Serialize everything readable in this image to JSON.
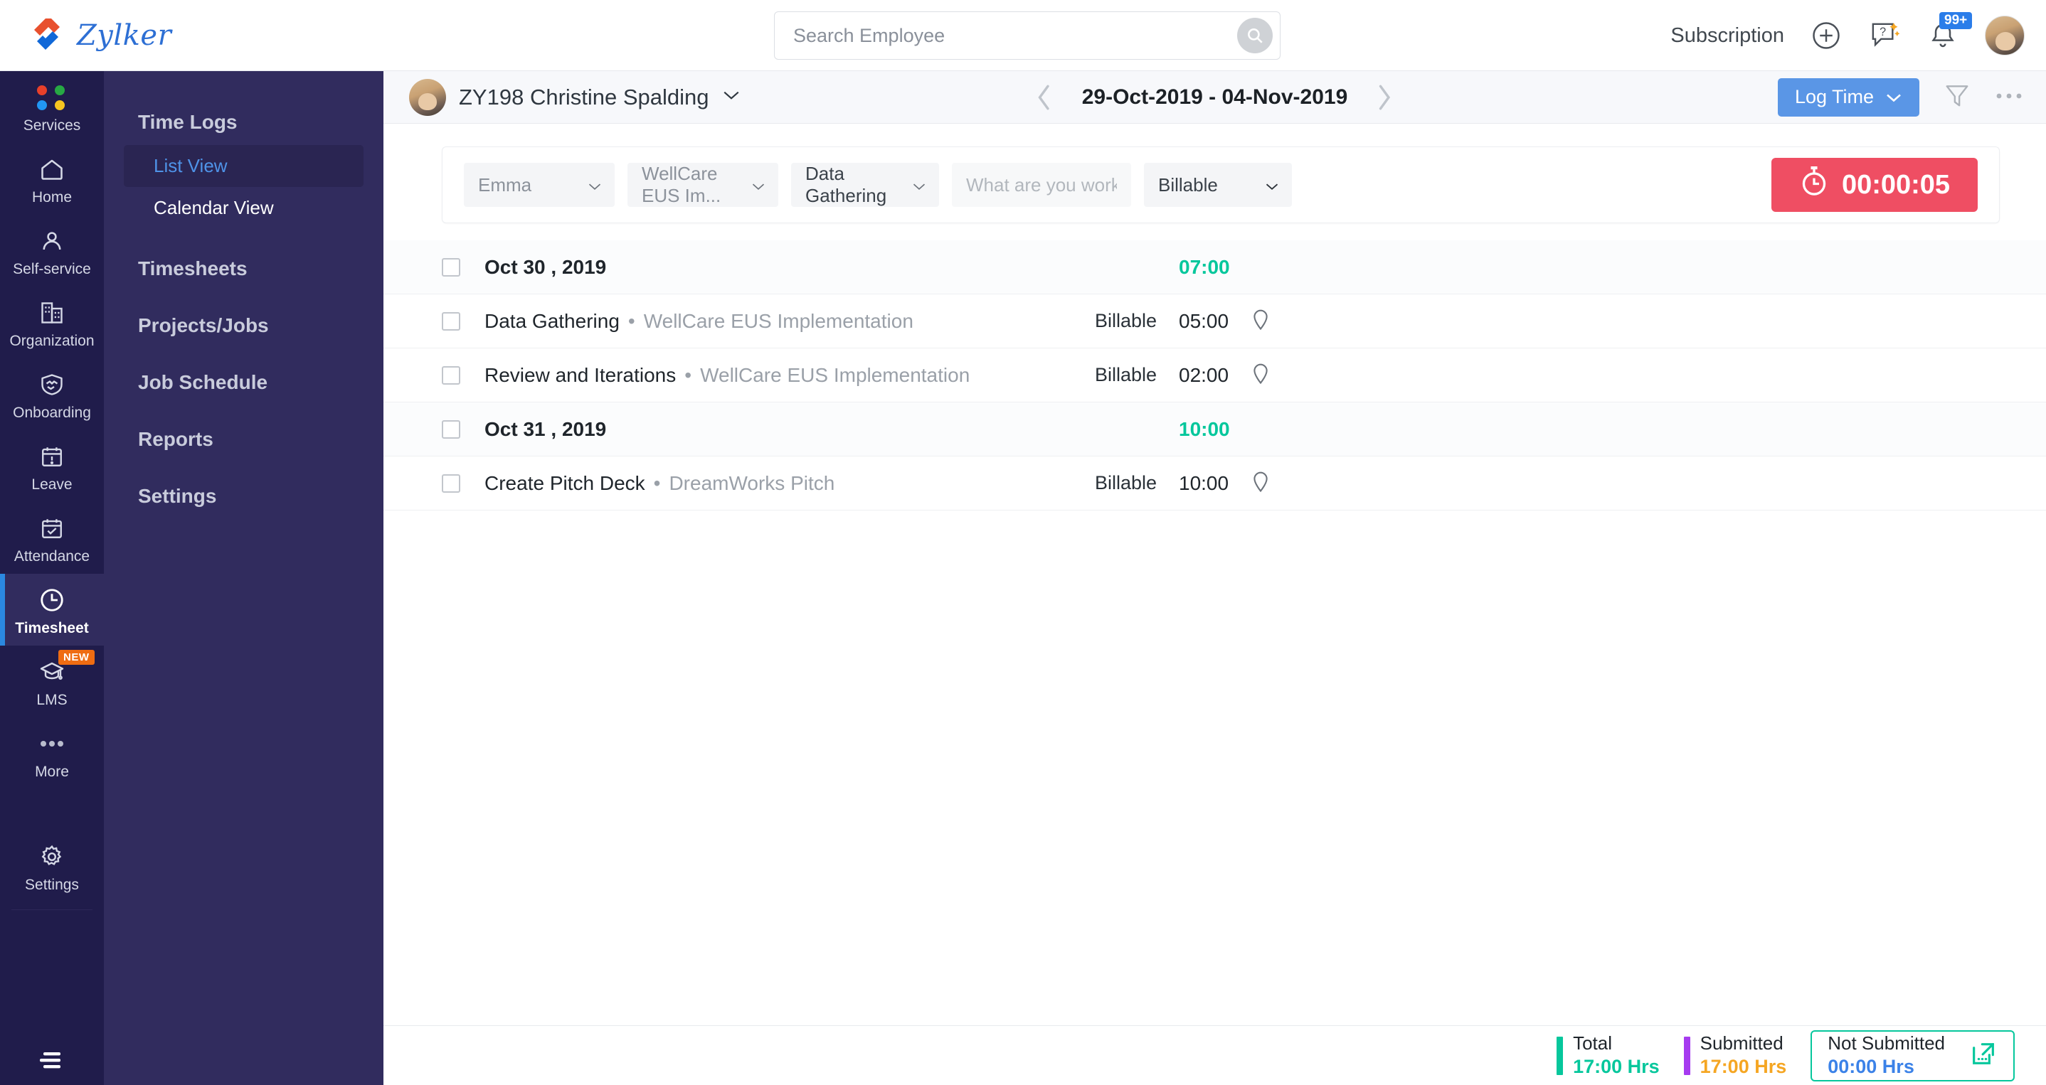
{
  "brand": {
    "name": "Zylker"
  },
  "topbar": {
    "search": {
      "placeholder": "Search Employee",
      "value": "",
      "icon": "search-icon"
    },
    "subscription_label": "Subscription",
    "add_icon": "plus-circle-icon",
    "help_icon": "help-chat-icon",
    "notification_icon": "bell-icon",
    "notification_badge": "99+",
    "avatar_icon": "user-avatar"
  },
  "rail": {
    "items": [
      {
        "label": "Services",
        "icon": "services-dots-icon",
        "active": false
      },
      {
        "label": "Home",
        "icon": "home-icon",
        "active": false
      },
      {
        "label": "Self-service",
        "icon": "person-icon",
        "active": false
      },
      {
        "label": "Organization",
        "icon": "buildings-icon",
        "active": false
      },
      {
        "label": "Onboarding",
        "icon": "handshake-shield-icon",
        "active": false
      },
      {
        "label": "Leave",
        "icon": "calendar-alert-icon",
        "active": false
      },
      {
        "label": "Attendance",
        "icon": "calendar-check-icon",
        "active": false
      },
      {
        "label": "Timesheet",
        "icon": "clock-icon",
        "active": true
      },
      {
        "label": "LMS",
        "icon": "graduation-cap-icon",
        "active": false,
        "badge": "NEW"
      },
      {
        "label": "More",
        "icon": "ellipsis-icon",
        "active": false
      },
      {
        "label": "Settings",
        "icon": "gear-icon",
        "active": false
      }
    ],
    "menu_icon": "hamburger-icon"
  },
  "subnav": {
    "groups": [
      {
        "title": "Time Logs",
        "children": [
          {
            "label": "List View",
            "active": true
          },
          {
            "label": "Calendar View",
            "active": false
          }
        ]
      }
    ],
    "items": [
      {
        "label": "Timesheets"
      },
      {
        "label": "Projects/Jobs"
      },
      {
        "label": "Job Schedule"
      },
      {
        "label": "Reports"
      },
      {
        "label": "Settings"
      }
    ]
  },
  "content_header": {
    "employee": "ZY198 Christine Spalding",
    "employee_chevron": "chevron-down-icon",
    "prev_icon": "chevron-left-icon",
    "next_icon": "chevron-right-icon",
    "date_range": "29-Oct-2019 - 04-Nov-2019",
    "log_time_label": "Log Time",
    "log_time_chevron": "chevron-down-icon",
    "filter_icon": "funnel-filter-icon",
    "more_icon": "ellipsis-icon"
  },
  "timer_bar": {
    "user_select": {
      "value": "Emma",
      "chevron": "chevron-down-icon"
    },
    "project_select": {
      "value": "WellCare EUS Im...",
      "chevron": "chevron-down-icon"
    },
    "job_select": {
      "value": "Data Gathering",
      "chevron": "chevron-down-icon"
    },
    "description": {
      "value": "",
      "placeholder": "What are you working on?"
    },
    "billable_select": {
      "value": "Billable",
      "chevron": "chevron-down-icon"
    },
    "timer": {
      "value": "00:00:05",
      "icon": "stopwatch-icon",
      "color": "#ef4e63"
    }
  },
  "list": {
    "rows": [
      {
        "type": "date",
        "title": "Oct 30 , 2019",
        "project": "",
        "billable": "",
        "hours": "07:00",
        "pin": false
      },
      {
        "type": "entry",
        "title": "Data Gathering",
        "project": "WellCare EUS Implementation",
        "billable": "Billable",
        "hours": "05:00",
        "pin": true
      },
      {
        "type": "entry",
        "title": "Review and Iterations",
        "project": "WellCare EUS Implementation",
        "billable": "Billable",
        "hours": "02:00",
        "pin": true
      },
      {
        "type": "date",
        "title": "Oct 31 , 2019",
        "project": "",
        "billable": "",
        "hours": "10:00",
        "pin": false
      },
      {
        "type": "entry",
        "title": "Create Pitch Deck",
        "project": "DreamWorks Pitch",
        "billable": "Billable",
        "hours": "10:00",
        "pin": true
      }
    ]
  },
  "footer": {
    "total": {
      "label": "Total",
      "value": "17:00 Hrs",
      "bar_color": "#06c79c",
      "value_color": "#06c79c"
    },
    "submitted": {
      "label": "Submitted",
      "value": "17:00 Hrs",
      "bar_color": "#a63bf0",
      "value_color": "#f5a623"
    },
    "not_submitted": {
      "label": "Not Submitted",
      "value": "00:00 Hrs",
      "value_color": "#3b82e8",
      "icon": "external-submit-icon"
    }
  },
  "colors": {
    "rail_bg": "#201c4b",
    "subnav_bg": "#312c5e",
    "accent_blue": "#5a96e6",
    "accent_green": "#06c79c",
    "timer_red": "#ef4e63",
    "badge_orange": "#ef6c12"
  }
}
